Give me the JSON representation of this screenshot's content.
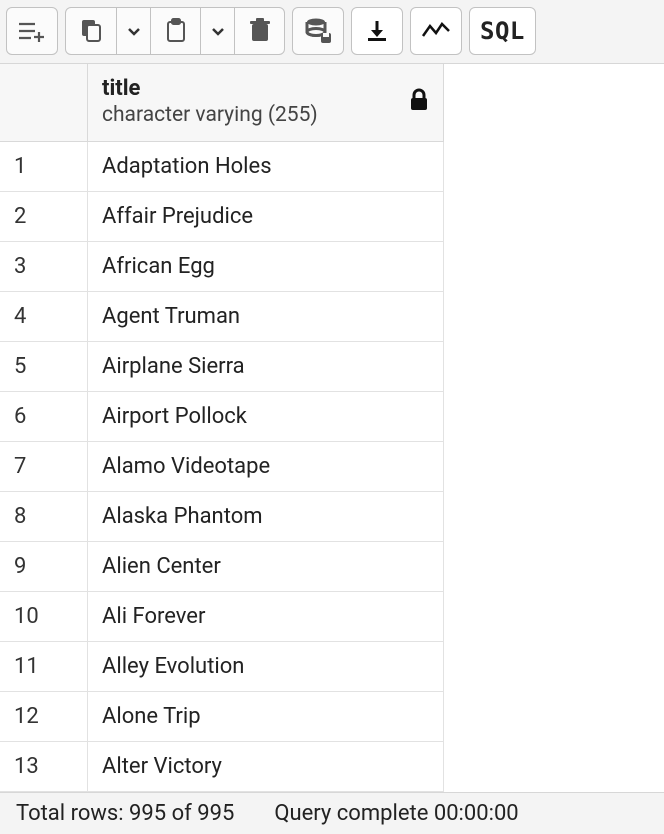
{
  "toolbar": {
    "add_row_label": "Add row",
    "copy_label": "Copy",
    "copy_menu_label": "Copy options",
    "paste_label": "Paste",
    "paste_menu_label": "Paste options",
    "delete_label": "Delete",
    "save_data_label": "Save data changes",
    "download_label": "Download",
    "chart_label": "Graph visualizer",
    "sql_label": "SQL"
  },
  "grid": {
    "column": {
      "name": "title",
      "type": "character varying (255)",
      "locked": true
    },
    "rows": [
      {
        "n": "1",
        "v": "Adaptation Holes"
      },
      {
        "n": "2",
        "v": "Affair Prejudice"
      },
      {
        "n": "3",
        "v": "African Egg"
      },
      {
        "n": "4",
        "v": "Agent Truman"
      },
      {
        "n": "5",
        "v": "Airplane Sierra"
      },
      {
        "n": "6",
        "v": "Airport Pollock"
      },
      {
        "n": "7",
        "v": "Alamo Videotape"
      },
      {
        "n": "8",
        "v": "Alaska Phantom"
      },
      {
        "n": "9",
        "v": "Alien Center"
      },
      {
        "n": "10",
        "v": "Ali Forever"
      },
      {
        "n": "11",
        "v": "Alley Evolution"
      },
      {
        "n": "12",
        "v": "Alone Trip"
      },
      {
        "n": "13",
        "v": "Alter Victory"
      }
    ]
  },
  "status": {
    "total_rows": "Total rows: 995 of 995",
    "query_complete": "Query complete 00:00:00"
  }
}
